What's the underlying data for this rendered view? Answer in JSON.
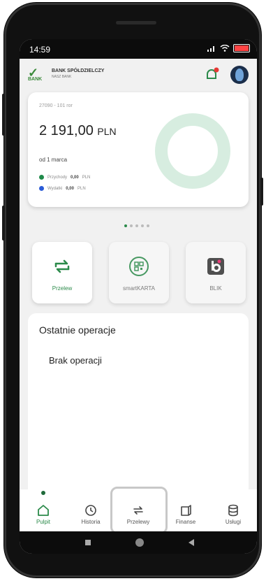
{
  "status": {
    "time": "14:59"
  },
  "brand": {
    "mark": "✓",
    "bank": "BANK",
    "name": "BANK SPÓŁDZIELCZY",
    "sub": "NASZ BANK"
  },
  "colors": {
    "accent": "#2b8a4a",
    "income": "#1f8a4a",
    "expense": "#2a5bd7",
    "notification": "#e53935"
  },
  "balance": {
    "account": "27090 - 101 ror",
    "amount": "2 191,00",
    "currency": "PLN",
    "since": "od 1 marca",
    "income_label": "Przychody",
    "income_value": "0,00",
    "expense_label": "Wydatki",
    "expense_value": "0,00",
    "unit": "PLN"
  },
  "pager": {
    "total": 5,
    "active": 0
  },
  "tiles": [
    {
      "label": "Przelew",
      "icon": "transfer-icon"
    },
    {
      "label": "smartKARTA",
      "icon": "qr-icon"
    },
    {
      "label": "BLIK",
      "icon": "blik-icon"
    }
  ],
  "operations": {
    "title": "Ostatnie operacje",
    "empty": "Brak operacji"
  },
  "nav": [
    {
      "label": "Pulpit",
      "icon": "home-icon"
    },
    {
      "label": "Historia",
      "icon": "history-icon"
    },
    {
      "label": "Przelewy",
      "icon": "transfer-icon"
    },
    {
      "label": "Finanse",
      "icon": "finance-icon"
    },
    {
      "label": "Usługi",
      "icon": "services-icon"
    }
  ]
}
